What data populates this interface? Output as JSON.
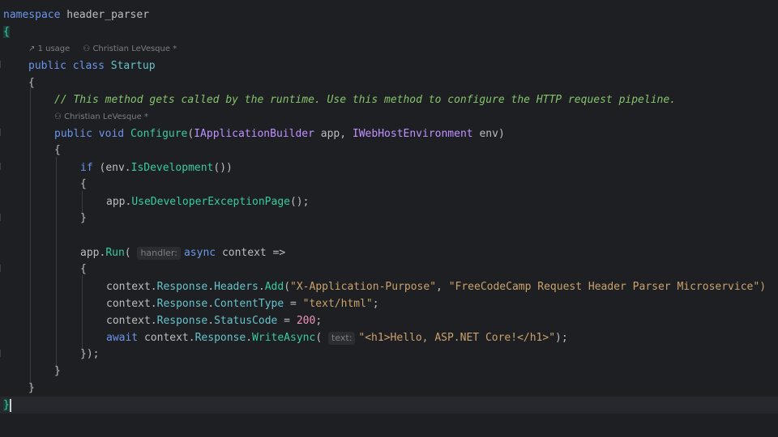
{
  "namespace_kw": "namespace",
  "namespace_name": "header_parser",
  "open_brace": "{",
  "close_brace": "}",
  "class_lens": {
    "usages": "1 usage",
    "author": "Christian LeVesque *"
  },
  "method_lens": {
    "author": "Christian LeVesque *"
  },
  "kw_public": "public",
  "kw_class": "class",
  "class_name": "Startup",
  "comment": "// This method gets called by the runtime. Use this method to configure the HTTP request pipeline.",
  "kw_void": "void",
  "method_name": "Configure",
  "param1_type": "IApplicationBuilder",
  "param1_name": "app",
  "param2_type": "IWebHostEnvironment",
  "param2_name": "env",
  "kw_if": "if",
  "env_var": "env",
  "is_dev": "IsDevelopment",
  "app_var": "app",
  "use_dev_page": "UseDeveloperExceptionPage",
  "run_method": "Run",
  "handler_hint": "handler:",
  "kw_async": "async",
  "context_var": "context",
  "arrow": "=>",
  "response_prop": "Response",
  "headers_prop": "Headers",
  "add_method": "Add",
  "header_name": "\"X-Application-Purpose\"",
  "header_value": "\"FreeCodeCamp Request Header Parser Microservice\")",
  "content_type_prop": "ContentType",
  "content_type_value": "\"text/html\"",
  "status_code_prop": "StatusCode",
  "status_code_value": "200",
  "kw_await": "await",
  "write_async": "WriteAsync",
  "text_hint": "text:",
  "html_string": "\"<h1>Hello, ASP.NET Core!</h1>\""
}
